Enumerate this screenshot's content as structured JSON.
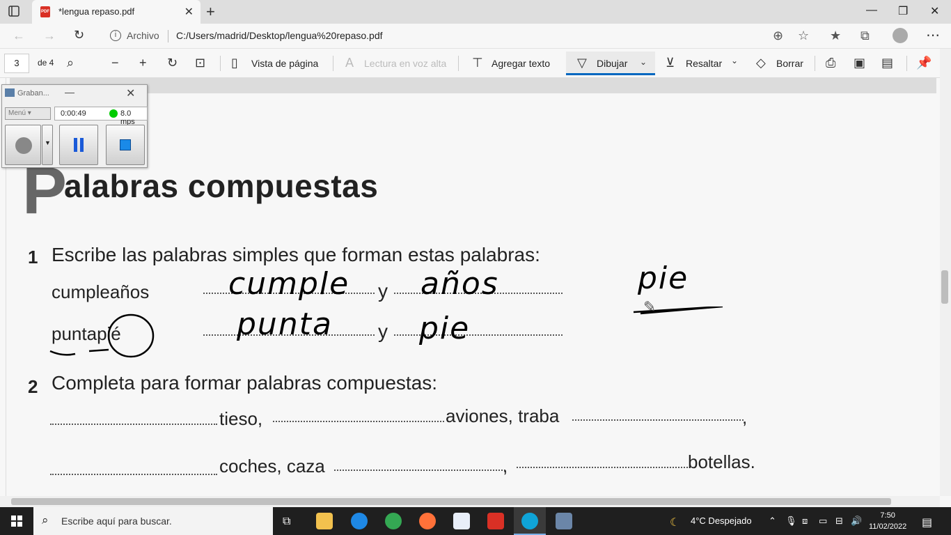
{
  "browser": {
    "tab_title": "*lengua repaso.pdf",
    "archivo_label": "Archivo",
    "url": "C:/Users/madrid/Desktop/lengua%20repaso.pdf"
  },
  "pdf_toolbar": {
    "page_number": "3",
    "page_total": "de 4",
    "page_view": "Vista de página",
    "read_aloud": "Lectura en voz alta",
    "add_text": "Agregar texto",
    "draw": "Dibujar",
    "highlight": "Resaltar",
    "erase": "Borrar"
  },
  "recorder": {
    "title": "Graban...",
    "menu": "Menú",
    "time": "0:00:49",
    "rate": "8.0 mps"
  },
  "document": {
    "heading_initial": "P",
    "heading_rest": "alabras compuestas",
    "q1_num": "1",
    "q1_text": "Escribe las palabras simples que forman estas palabras:",
    "row1_word": "cumpleaños",
    "row2_word": "puntapié",
    "y1": "y",
    "y2": "y",
    "hw_cumple": "cumple",
    "hw_anos": "años",
    "hw_punta": "punta",
    "hw_pie": "pie",
    "hw_pie_note": "pie",
    "q2_num": "2",
    "q2_text": "Completa para formar palabras compuestas:",
    "tieso": "tieso,",
    "aviones": "aviones, traba",
    "comma_end": ",",
    "coches": "coches,  caza",
    "comma_mid": ",",
    "botellas": "botellas."
  },
  "taskbar": {
    "search_placeholder": "Escribe aquí para buscar.",
    "weather": "4°C  Despejado",
    "time": "7:50",
    "date": "11/02/2022"
  },
  "colors": {
    "accent": "#0067c0",
    "taskbar": "#1f1f1f",
    "pdf_red": "#d93025"
  }
}
